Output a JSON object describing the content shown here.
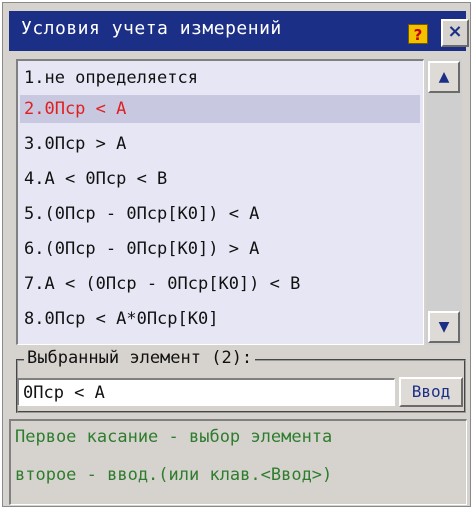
{
  "window": {
    "title": "Условия учета измерений",
    "help_icon": "?",
    "close_icon": "×"
  },
  "list": {
    "items": [
      {
        "label": "1.не определяется",
        "selected": false
      },
      {
        "label": "2.0Пср < A",
        "selected": true
      },
      {
        "label": "3.0Пср > A",
        "selected": false
      },
      {
        "label": "4.A < 0Пср < B",
        "selected": false
      },
      {
        "label": "5.(0Пср - 0Пср[K0]) < A",
        "selected": false
      },
      {
        "label": "6.(0Пср - 0Пср[K0]) > A",
        "selected": false
      },
      {
        "label": "7.A < (0Пср - 0Пср[K0]) < B",
        "selected": false
      },
      {
        "label": "8.0Пср < A*0Пср[K0]",
        "selected": false
      }
    ],
    "selected_color": "#e02020"
  },
  "scrollbar": {
    "up_icon": "▲",
    "down_icon": "▼"
  },
  "selection": {
    "label": "Выбранный элемент (2):",
    "value": "0Пср < A",
    "enter_label": "Ввод"
  },
  "hint": {
    "line1": "Первое касание - выбор элемента",
    "line2": "второе - ввод.(или клав.<Ввод>)"
  },
  "colors": {
    "titlebar": "#1c2f86",
    "hint_text": "#2e7d2e",
    "list_bg": "#e6e6f5"
  }
}
